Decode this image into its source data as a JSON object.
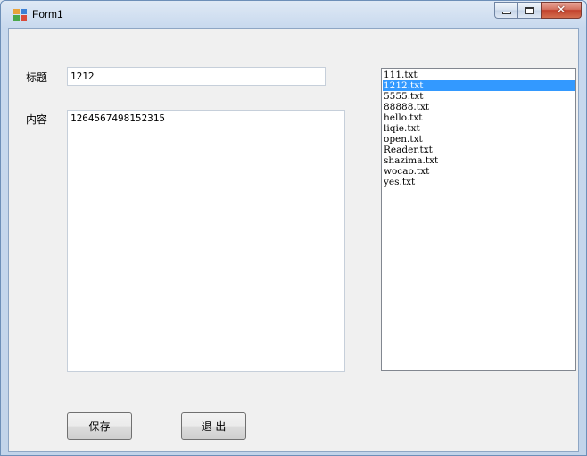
{
  "window": {
    "title": "Form1",
    "icon": "winforms-app-icon",
    "controls": {
      "minimize": "minimize-icon",
      "maximize": "maximize-icon",
      "close": "close-icon"
    }
  },
  "form": {
    "title_label": "标题",
    "title_value": "1212",
    "content_label": "内容",
    "content_value": "1264567498152315"
  },
  "file_list": {
    "selected": "1212.txt",
    "items": [
      "111.txt",
      "1212.txt",
      "5555.txt",
      "88888.txt",
      "hello.txt",
      "liqie.txt",
      "open.txt",
      "Reader.txt",
      "shazima.txt",
      "wocao.txt",
      "yes.txt"
    ]
  },
  "buttons": {
    "save_label": "保存",
    "exit_label": "退 出"
  },
  "colors": {
    "selection": "#3399ff",
    "form_background": "#f0f0f0",
    "close_button": "#c2412c"
  }
}
